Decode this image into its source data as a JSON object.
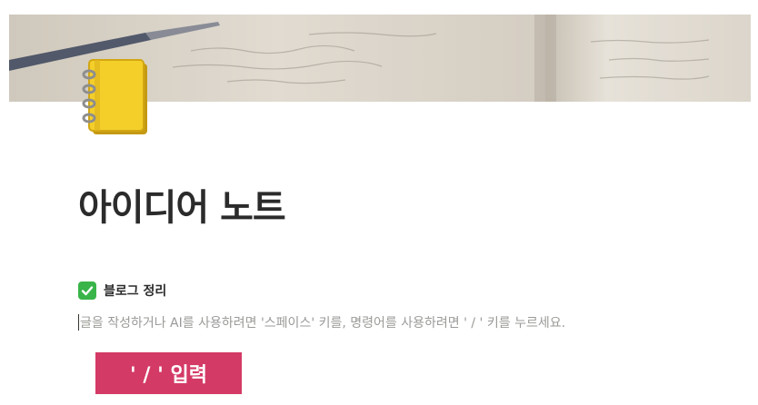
{
  "cover": {
    "description_icon": "notebook-cover-image"
  },
  "page": {
    "icon": "notebook-icon",
    "title": "아이디어 노트"
  },
  "todo": {
    "checked": true,
    "icon": "check-mark-button-icon",
    "label": "블로그 정리"
  },
  "editor": {
    "placeholder": "글을 작성하거나 AI를 사용하려면 '스페이스' 키를, 명령어를 사용하려면 ' / ' 키를 누르세요."
  },
  "hint": {
    "label": "' / ' 입력"
  },
  "colors": {
    "accent": "#d43a66",
    "check": "#38b449",
    "title": "#2b2b2b",
    "placeholder": "#9b9a97"
  }
}
